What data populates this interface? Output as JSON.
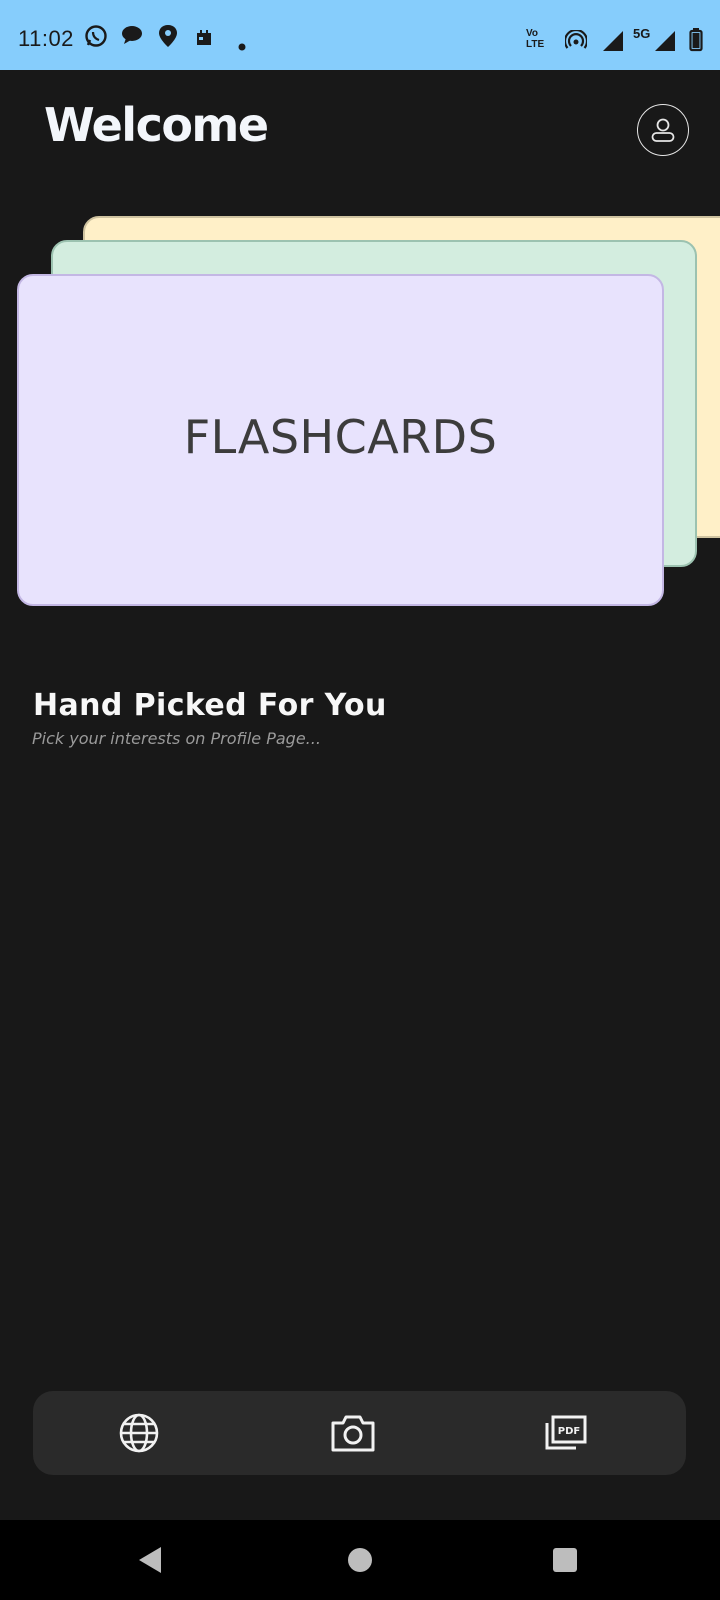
{
  "status_bar": {
    "time": "11:02",
    "network_label": "5G",
    "volte_label_top": "Vo",
    "volte_label_bottom": "LTE",
    "background_color": "#86cdfc",
    "left_icons": [
      "whatsapp-icon",
      "chat-bubble-icon",
      "location-icon",
      "calendar-icon",
      "dot-icon"
    ],
    "right_icons": [
      "volte-icon",
      "hotspot-icon",
      "signal-icon",
      "5g-signal-icon",
      "battery-icon"
    ]
  },
  "header": {
    "title": "Welcome",
    "profile_icon": "user-icon"
  },
  "hero": {
    "card_title": "FLASHCARDS",
    "card_colors": [
      "#e8e3fd",
      "#d3eddf",
      "#fff0c8"
    ]
  },
  "section": {
    "title": "Hand Picked For You",
    "subtitle": "Pick your interests on Profile Page..."
  },
  "bottom_nav": {
    "items": [
      {
        "icon": "globe-icon"
      },
      {
        "icon": "camera-icon"
      },
      {
        "icon": "pdf-icon",
        "badge_text": "PDF"
      }
    ]
  },
  "system_nav": {
    "items": [
      "back-icon",
      "home-icon",
      "recents-icon"
    ]
  }
}
